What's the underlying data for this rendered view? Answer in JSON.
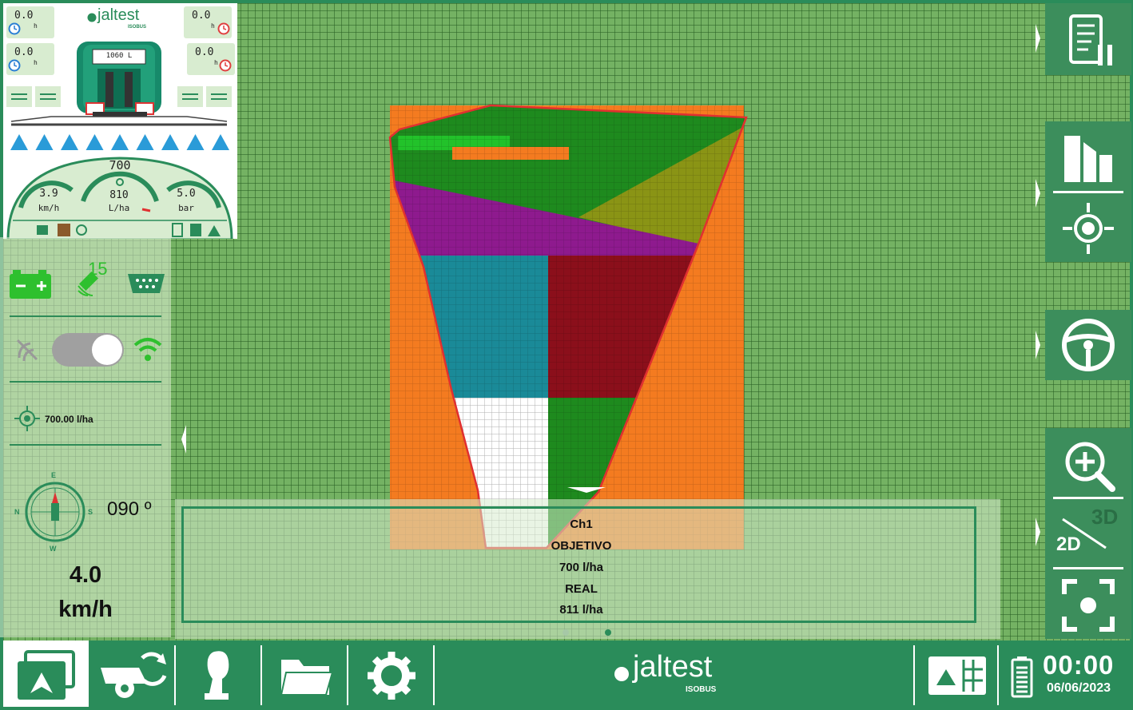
{
  "dashboard": {
    "logo_text": "jaltest",
    "logo_sub": "ISOBUS",
    "timers": [
      {
        "value": "0.0",
        "unit": "h"
      },
      {
        "value": "0.0",
        "unit": "h"
      },
      {
        "value": "0.0",
        "unit": "h"
      },
      {
        "value": "0.0",
        "unit": "h"
      }
    ],
    "tank_volume": "1060  L",
    "target_rate_gauge": "700",
    "speed_gauge": {
      "value": "3.9",
      "unit": "km/h"
    },
    "rate_gauge": {
      "value": "810",
      "unit": "L/ha"
    },
    "pressure_gauge": {
      "value": "5.0",
      "unit": "bar"
    },
    "nozzle_count": 9
  },
  "status": {
    "satellites": "15",
    "target_rate": "700.00 l/ha",
    "heading": "090 º",
    "speed_value": "4.0",
    "speed_unit": "km/h",
    "compass": {
      "n": "N",
      "e": "E",
      "s": "S",
      "w": "W"
    },
    "toggle_on": true
  },
  "info_box": {
    "channel": "Ch1",
    "target_label": "OBJETIVO",
    "target_value": "700 l/ha",
    "real_label": "REAL",
    "real_value": "811 l/ha"
  },
  "right_toolbar": {
    "view_3d": "3D",
    "view_2d": "2D"
  },
  "bottom_bar": {
    "logo_text": "jaltest",
    "logo_sub": "ISOBUS",
    "time": "00:00",
    "date": "06/06/2023"
  },
  "colors": {
    "brand_green": "#2a8c5a",
    "map_grid": "#74b263",
    "field_border": "#e03030",
    "coverage_orange": "#f47b20"
  }
}
